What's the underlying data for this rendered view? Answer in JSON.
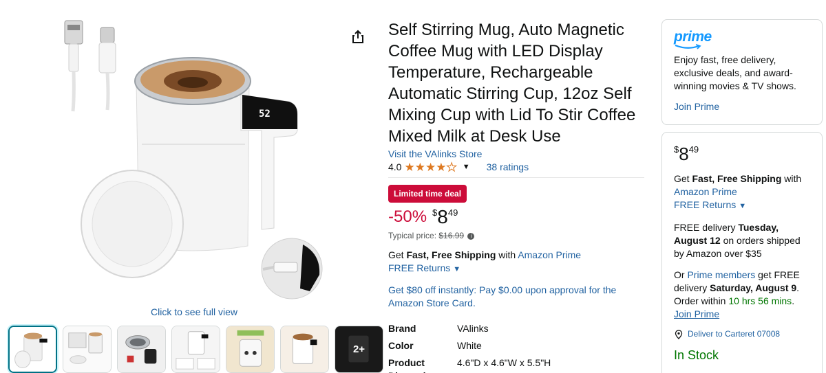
{
  "gallery": {
    "see_full_view": "Click to see full view",
    "thumbnails": [
      {
        "name": "thumb-mug-front"
      },
      {
        "name": "thumb-package-contents"
      },
      {
        "name": "thumb-mug-detail"
      },
      {
        "name": "thumb-features-infographic"
      },
      {
        "name": "thumb-type-c-charge"
      },
      {
        "name": "thumb-stirring"
      },
      {
        "name": "thumb-video",
        "more_label": "2+"
      }
    ],
    "share_icon": "share-icon"
  },
  "product": {
    "title": "Self Stirring Mug, Auto Magnetic Coffee Mug with LED Display Temperature, Rechargeable Automatic Stirring Cup, 12oz Self Mixing Cup with Lid To Stir Coffee Mixed Milk at Desk Use",
    "store_link": "Visit the VAlinks Store",
    "rating_value": "4.0",
    "rating_stars": 4.0,
    "ratings_count": "38 ratings",
    "deal_badge": "Limited time deal",
    "discount": "-50%",
    "price_symbol": "$",
    "price_whole": "8",
    "price_fraction": "49",
    "typical_label": "Typical price:",
    "typical_price": "$16.99",
    "shipping_prefix": "Get ",
    "shipping_bold": "Fast, Free Shipping",
    "shipping_with": " with ",
    "shipping_prime": "Amazon Prime",
    "free_returns": "FREE Returns",
    "promo": "Get $80 off instantly: Pay $0.00 upon approval for the Amazon Store Card.",
    "specs": [
      {
        "key": "Brand",
        "value": "VAlinks"
      },
      {
        "key": "Color",
        "value": "White"
      },
      {
        "key": "Product Dimensions",
        "value": "4.6\"D x 4.6\"W x 5.5\"H"
      }
    ]
  },
  "prime_box": {
    "logo": "prime",
    "description": "Enjoy fast, free delivery, exclusive deals, and award-winning movies & TV shows.",
    "join": "Join Prime"
  },
  "buy_box": {
    "price_symbol": "$",
    "price_whole": "8",
    "price_fraction": "49",
    "shipping_prefix": "Get ",
    "shipping_bold": "Fast, Free Shipping",
    "shipping_with": " with",
    "shipping_prime": "Amazon Prime",
    "free_returns": "FREE Returns",
    "delivery_prefix": "FREE delivery ",
    "delivery_date": "Tuesday, August 12",
    "delivery_suffix": " on orders shipped by Amazon over $35",
    "or_prefix": "Or ",
    "prime_members": "Prime members",
    "get_free": " get FREE delivery ",
    "fast_date": "Saturday, August 9",
    "order_within_prefix": ". Order within ",
    "countdown": "10 hrs 56 mins",
    "order_within_suffix": ".",
    "join_prime": "Join Prime",
    "deliver_to": "Deliver to Carteret 07008",
    "stock": "In Stock"
  },
  "colors": {
    "link": "#2162a1",
    "deal": "#cc0c39",
    "star": "#de7921",
    "prime_blue": "#1399ff",
    "in_stock": "#007600"
  }
}
